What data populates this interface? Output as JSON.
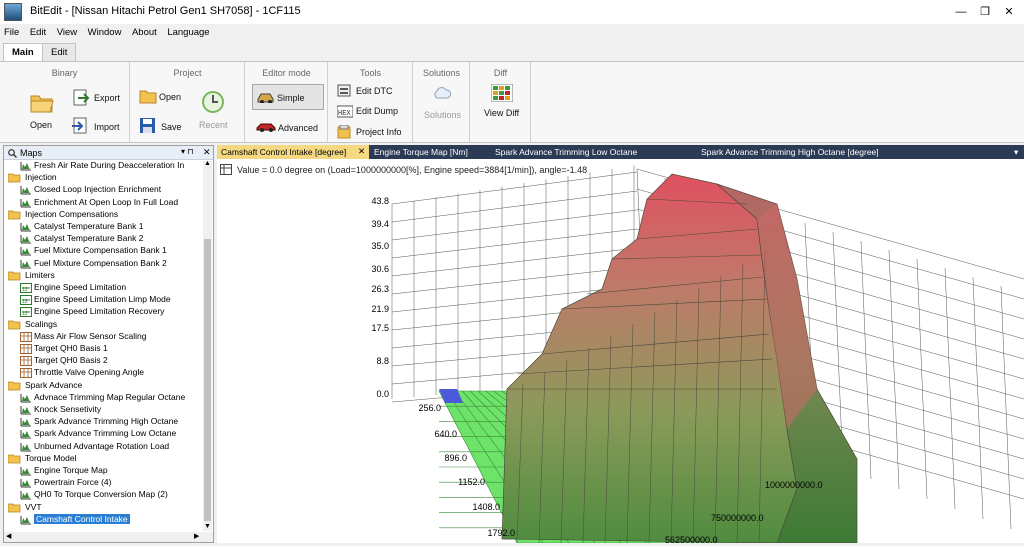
{
  "window": {
    "title": "BitEdit - [Nissan Hitachi Petrol Gen1 SH7058] - 1CF115"
  },
  "menu": [
    "File",
    "Edit",
    "View",
    "Window",
    "About",
    "Language"
  ],
  "ribbon_tabs": [
    "Main",
    "Edit"
  ],
  "ribbon": {
    "binary": {
      "title": "Binary",
      "open": "Open",
      "export": "Export",
      "import": "Import"
    },
    "project": {
      "title": "Project",
      "open": "Open",
      "save": "Save",
      "recent": "Recent"
    },
    "editor_mode": {
      "title": "Editor mode",
      "simple": "Simple",
      "advanced": "Advanced"
    },
    "tools": {
      "title": "Tools",
      "edit_dtc": "Edit DTC",
      "edit_dump": "Edit Dump",
      "project_info": "Project Info"
    },
    "solutions": {
      "title": "Solutions",
      "solutions": "Solutions"
    },
    "diff": {
      "title": "Diff",
      "view_diff": "View Diff"
    }
  },
  "sidebar": {
    "title": "Maps",
    "pin": "▾ ⊓",
    "close": "✕",
    "items": [
      {
        "level": 2,
        "type": "map2d",
        "label": "Fresh Air Rate During Deacceleration In"
      },
      {
        "level": 1,
        "type": "folder",
        "label": "Injection"
      },
      {
        "level": 2,
        "type": "map2d",
        "label": "Closed Loop Injection Enrichment"
      },
      {
        "level": 2,
        "type": "map2d",
        "label": "Enrichment At Open Loop In Full Load"
      },
      {
        "level": 1,
        "type": "folder",
        "label": "Injection Compensations"
      },
      {
        "level": 2,
        "type": "map2d",
        "label": "Catalyst Temperature Bank 1"
      },
      {
        "level": 2,
        "type": "map2d",
        "label": "Catalyst Temperature Bank 2"
      },
      {
        "level": 2,
        "type": "map2d",
        "label": "Fuel Mixture Compensation Bank 1"
      },
      {
        "level": 2,
        "type": "map2d",
        "label": "Fuel Mixture Compensation Bank 2"
      },
      {
        "level": 1,
        "type": "folder",
        "label": "Limiters"
      },
      {
        "level": 2,
        "type": "value",
        "label": "Engine Speed Limitation"
      },
      {
        "level": 2,
        "type": "value",
        "label": "Engine Speed Limitation Limp Mode"
      },
      {
        "level": 2,
        "type": "value",
        "label": "Engine Speed Limitation Recovery"
      },
      {
        "level": 1,
        "type": "folder",
        "label": "Scalings"
      },
      {
        "level": 2,
        "type": "table",
        "label": "Mass Air Flow Sensor Scaling"
      },
      {
        "level": 2,
        "type": "table",
        "label": "Target QH0 Basis 1"
      },
      {
        "level": 2,
        "type": "table",
        "label": "Target QH0 Basis 2"
      },
      {
        "level": 2,
        "type": "table",
        "label": "Throttle Valve Opening Angle"
      },
      {
        "level": 1,
        "type": "folder",
        "label": "Spark Advance"
      },
      {
        "level": 2,
        "type": "map2d",
        "label": "Advnace Trimming Map Regular Octane"
      },
      {
        "level": 2,
        "type": "map2d",
        "label": "Knock Sensetivity"
      },
      {
        "level": 2,
        "type": "map2d",
        "label": "Spark Advance Trimming High Octane"
      },
      {
        "level": 2,
        "type": "map2d",
        "label": "Spark Advance Trimming Low Octane"
      },
      {
        "level": 2,
        "type": "map2d",
        "label": "Unburned Advantage Rotation Load"
      },
      {
        "level": 1,
        "type": "folder",
        "label": "Torque Model"
      },
      {
        "level": 2,
        "type": "map2d",
        "label": "Engine Torque Map"
      },
      {
        "level": 2,
        "type": "map2d",
        "label": "Powertrain Force (4)"
      },
      {
        "level": 2,
        "type": "map2d",
        "label": "QH0 To Torque Conversion Map (2)"
      },
      {
        "level": 1,
        "type": "folder",
        "label": "VVT"
      },
      {
        "level": 2,
        "type": "map2d",
        "label": "Camshaft Control Intake",
        "selected": true
      }
    ]
  },
  "doc_tabs": [
    {
      "label": "Camshaft Control Intake [degree]",
      "active": true,
      "close": "✕"
    },
    {
      "label": "Engine Torque Map [Nm]"
    },
    {
      "label": "Spark Advance Trimming Low Octane"
    },
    {
      "label": "Spark Advance Trimming High Octane [degree]"
    }
  ],
  "doc_tabs_menu": "▾",
  "status_line": "Value = 0.0 degree on (Load=1000000000[%], Engine speed=3884[1/min]), angle=-1.48",
  "chart_data": {
    "type": "surface3d",
    "z_ticks": [
      "43.8",
      "39.4",
      "35.0",
      "30.6",
      "26.3",
      "21.9",
      "17.5",
      "8.8",
      "0.0"
    ],
    "rpm_ticks": [
      "256.0",
      "640.0",
      "896.0",
      "1152.0",
      "1408.0",
      "1792.0"
    ],
    "load_ticks": [
      "1000000000.0",
      "750000000.0",
      "562500000.0"
    ],
    "colors": {
      "low": "#5ec85a",
      "high": "#e05060",
      "floor": "#6ee36a"
    }
  },
  "colors": {
    "accent": "#2a7fd4",
    "doc_tab_bar": "#2b3a55",
    "active_tab": "#f5d982"
  }
}
